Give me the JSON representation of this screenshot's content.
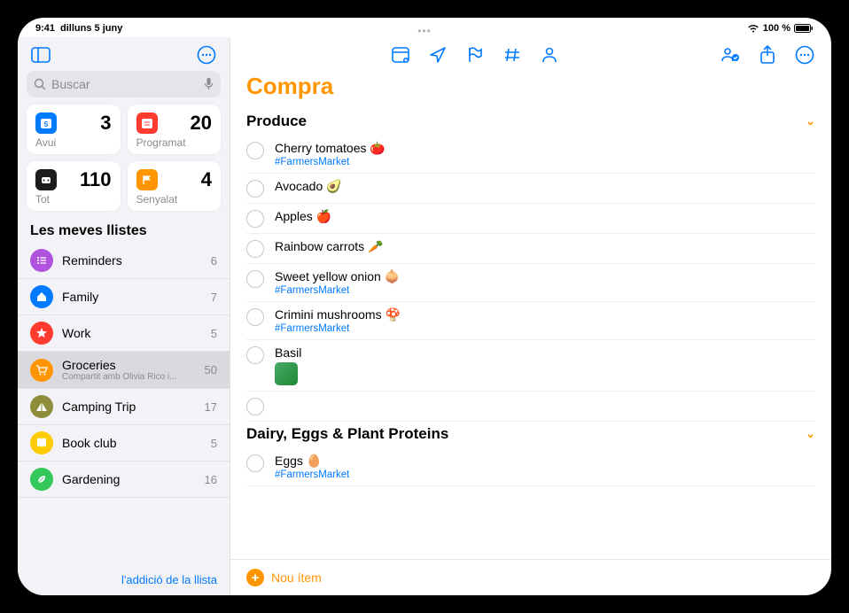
{
  "status": {
    "time": "9:41",
    "date": "dilluns 5 juny",
    "battery": "100 %"
  },
  "search": {
    "placeholder": "Buscar"
  },
  "smartLists": [
    {
      "label": "Avui",
      "count": "3",
      "color": "#007aff"
    },
    {
      "label": "Programat",
      "count": "20",
      "color": "#ff3b30"
    },
    {
      "label": "Tot",
      "count": "110",
      "color": "#1c1c1e"
    },
    {
      "label": "Senyalat",
      "count": "4",
      "color": "#ff9500"
    }
  ],
  "myListsHeader": "Les meves llistes",
  "lists": [
    {
      "name": "Reminders",
      "count": "6",
      "color": "#af52de",
      "icon": "list"
    },
    {
      "name": "Family",
      "count": "7",
      "color": "#007aff",
      "icon": "home"
    },
    {
      "name": "Work",
      "count": "5",
      "color": "#ff3b30",
      "icon": "star"
    },
    {
      "name": "Groceries",
      "count": "50",
      "color": "#ff9500",
      "icon": "cart",
      "sub": "Compartit amb Olivia Rico i...",
      "selected": true
    },
    {
      "name": "Camping Trip",
      "count": "17",
      "color": "#8e8e3a",
      "icon": "tent"
    },
    {
      "name": "Book club",
      "count": "5",
      "color": "#ffcc00",
      "icon": "book"
    },
    {
      "name": "Gardening",
      "count": "16",
      "color": "#34c759",
      "icon": "leaf"
    }
  ],
  "addListLabel": "l'addició de la llista",
  "detail": {
    "title": "Compra",
    "groups": [
      {
        "name": "Produce",
        "items": [
          {
            "text": "Cherry tomatoes 🍅",
            "tag": "#FarmersMarket"
          },
          {
            "text": "Avocado 🥑"
          },
          {
            "text": "Apples 🍎"
          },
          {
            "text": "Rainbow carrots 🥕"
          },
          {
            "text": "Sweet yellow onion 🧅",
            "tag": "#FarmersMarket"
          },
          {
            "text": "Crimini mushrooms 🍄",
            "tag": "#FarmersMarket"
          },
          {
            "text": "Basil",
            "thumb": true
          },
          {
            "text": "",
            "empty": true
          }
        ]
      },
      {
        "name": "Dairy, Eggs & Plant Proteins",
        "items": [
          {
            "text": "Eggs 🥚",
            "tag": "#FarmersMarket"
          }
        ]
      }
    ],
    "newItem": "Nou ítem"
  }
}
